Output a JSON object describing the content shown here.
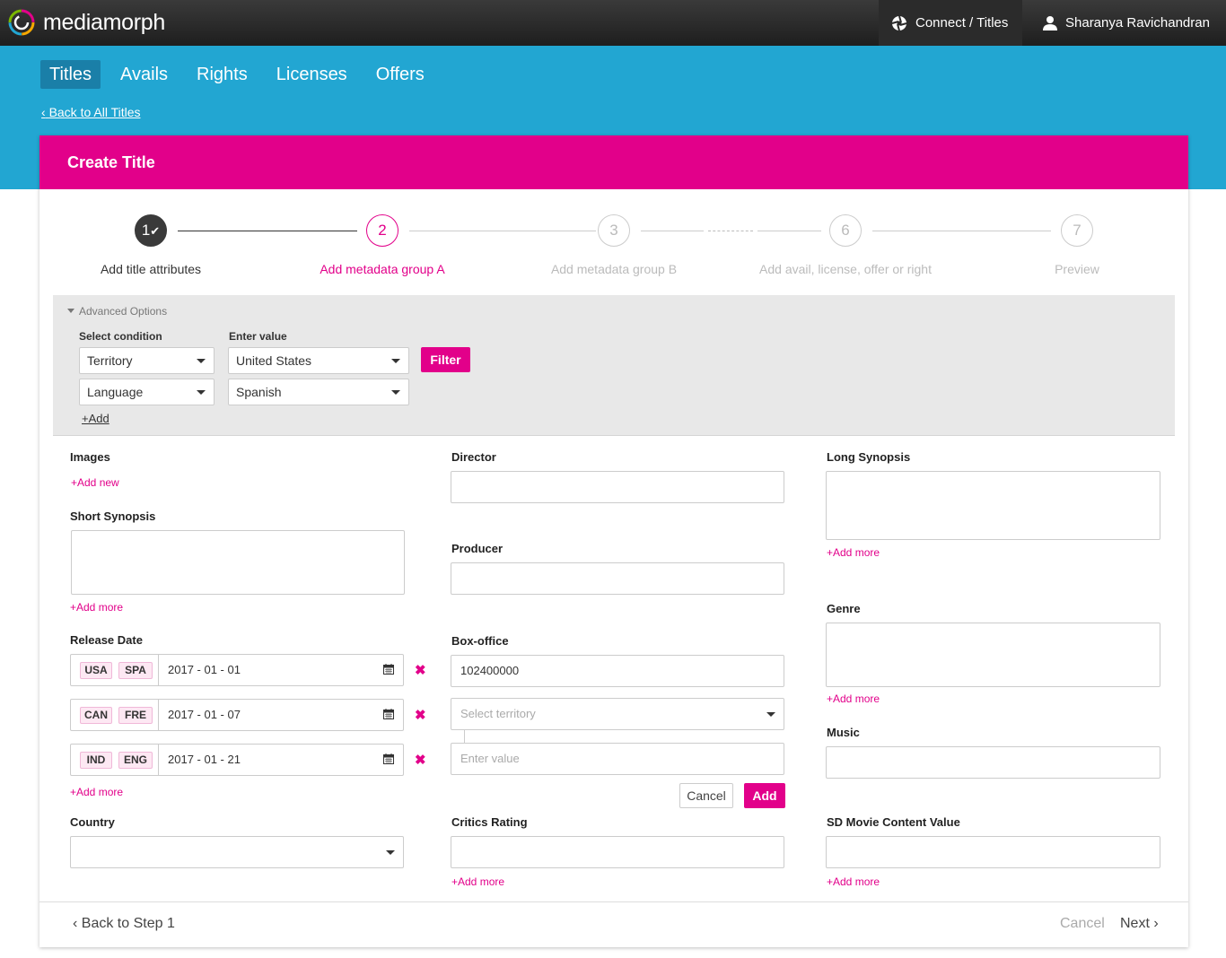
{
  "topbar": {
    "brand": "mediamorph",
    "connect_label": "Connect / Titles",
    "user_name": "Sharanya Ravichandran"
  },
  "nav": {
    "items": [
      {
        "label": "Titles",
        "active": true
      },
      {
        "label": "Avails"
      },
      {
        "label": "Rights"
      },
      {
        "label": "Licenses"
      },
      {
        "label": "Offers"
      }
    ],
    "back_label": "Back to All Titles"
  },
  "card": {
    "title": "Create Title"
  },
  "stepper": {
    "steps": [
      {
        "num": "1",
        "label": "Add title attributes",
        "state": "done"
      },
      {
        "num": "2",
        "label": "Add metadata group A",
        "state": "current"
      },
      {
        "num": "3",
        "label": "Add metadata group B",
        "state": "pending"
      },
      {
        "num": "6",
        "label": "Add avail, license, offer or right",
        "state": "pending"
      },
      {
        "num": "7",
        "label": "Preview",
        "state": "pending"
      }
    ]
  },
  "advanced": {
    "title": "Advanced Options",
    "condition_label": "Select condition",
    "value_label": "Enter value",
    "rows": [
      {
        "condition": "Territory",
        "value": "United States"
      },
      {
        "condition": "Language",
        "value": "Spanish"
      }
    ],
    "filter_label": "Filter",
    "add_label": "+Add"
  },
  "form": {
    "images": {
      "label": "Images",
      "add_label": "+Add new"
    },
    "short_synopsis": {
      "label": "Short Synopsis",
      "add_label": "+Add more"
    },
    "release_date": {
      "label": "Release Date",
      "rows": [
        {
          "territory": "USA",
          "language": "SPA",
          "date": "2017 - 01 - 01"
        },
        {
          "territory": "CAN",
          "language": "FRE",
          "date": "2017 - 01 - 07"
        },
        {
          "territory": "IND",
          "language": "ENG",
          "date": "2017 - 01 - 21"
        }
      ],
      "add_label": "+Add more"
    },
    "country": {
      "label": "Country",
      "value": ""
    },
    "director": {
      "label": "Director",
      "value": ""
    },
    "producer": {
      "label": "Producer",
      "value": ""
    },
    "box_office": {
      "label": "Box-office",
      "value": "102400000",
      "territory_placeholder": "Select territory",
      "value_placeholder": "Enter value",
      "cancel_label": "Cancel",
      "add_label": "Add"
    },
    "critics_rating": {
      "label": "Critics Rating",
      "add_label": "+Add more"
    },
    "long_synopsis": {
      "label": "Long Synopsis",
      "add_label": "+Add more"
    },
    "genre": {
      "label": "Genre",
      "add_label": "+Add more"
    },
    "music": {
      "label": "Music"
    },
    "sd_movie": {
      "label": "SD Movie Content Value",
      "add_label": "+Add more"
    }
  },
  "footer": {
    "back_label": "Back to Step 1",
    "cancel_label": "Cancel",
    "next_label": "Next"
  },
  "colors": {
    "accent": "#e2008a",
    "blue": "#22a6d2",
    "topbar": "#262626"
  }
}
